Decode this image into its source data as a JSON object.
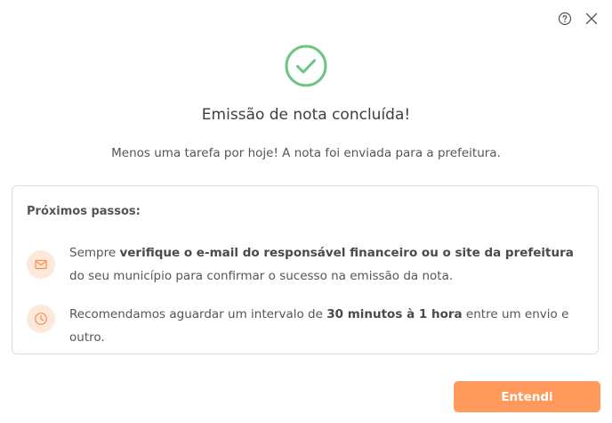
{
  "header": {
    "help_icon": "help-circle-icon",
    "close_icon": "close-icon"
  },
  "status": {
    "icon": "check-circle-icon",
    "color": "#6cc583"
  },
  "title": "Emissão de nota concluída!",
  "subtitle": "Menos uma tarefa por hoje! A nota foi enviada para a prefeitura.",
  "next_steps": {
    "title": "Próximos passos:",
    "items": [
      {
        "icon": "mail-icon",
        "text_1": "Sempre ",
        "bold_1": "verifique o e-mail do responsável financeiro ou o site da prefeitura",
        "text_2": " do seu município para confirmar o sucesso na emissão da nota."
      },
      {
        "icon": "clock-icon",
        "text_1": "Recomendamos aguardar um intervalo de ",
        "bold_1": "30 minutos à 1 hora",
        "text_2": " entre um envio e outro."
      }
    ]
  },
  "actions": {
    "confirm_label": "Entendi"
  },
  "colors": {
    "accent": "#ff9a5c",
    "icon_bg": "#fde9dc",
    "success": "#6cc583"
  }
}
